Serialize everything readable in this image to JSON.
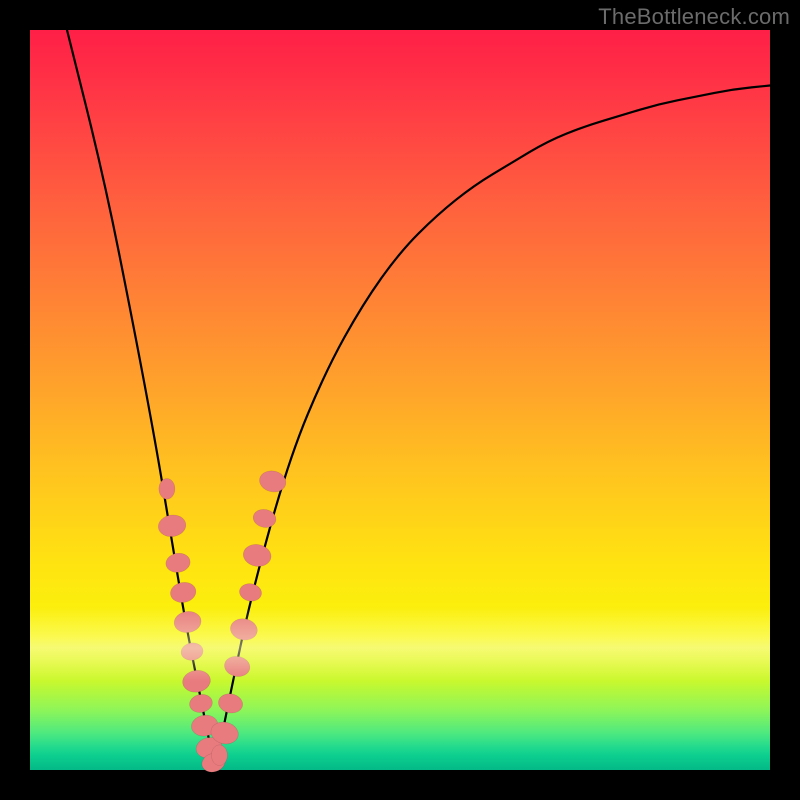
{
  "watermark": "TheBottleneck.com",
  "colors": {
    "bead": "#e87b7e",
    "curve": "#000000",
    "frame": "#000000"
  },
  "chart_data": {
    "type": "line",
    "title": "",
    "xlabel": "",
    "ylabel": "",
    "xlim": [
      0,
      100
    ],
    "ylim": [
      0,
      100
    ],
    "grid": false,
    "legend": false,
    "notes": "V-shaped bottleneck curve on a vertical color gradient; y ≈ 100 (red, severe) at top, y ≈ 0 (green, balanced) at bottom. Minimum at x ≈ 25. Pink beads mark sampled points near the minimum.",
    "series": [
      {
        "name": "bottleneck-curve",
        "x": [
          5,
          10,
          14,
          17,
          19,
          21,
          23,
          25,
          27,
          30,
          35,
          40,
          45,
          50,
          55,
          60,
          65,
          70,
          75,
          80,
          85,
          90,
          95,
          100
        ],
        "y": [
          100,
          80,
          60,
          44,
          32,
          20,
          10,
          0,
          10,
          24,
          42,
          54,
          63,
          70,
          75,
          79,
          82,
          85,
          87,
          88.5,
          90,
          91,
          92,
          92.5
        ]
      }
    ],
    "beads_left": {
      "name": "samples-left-branch",
      "x": [
        18.5,
        19.2,
        20.0,
        20.7,
        21.3,
        21.9,
        22.5,
        23.1,
        23.6,
        24.2,
        24.8
      ],
      "y": [
        38,
        33,
        28,
        24,
        20,
        16,
        12,
        9,
        6,
        3,
        1
      ]
    },
    "beads_right": {
      "name": "samples-right-branch",
      "x": [
        25.6,
        26.3,
        27.1,
        28.0,
        28.9,
        29.8,
        30.7,
        31.7,
        32.8
      ],
      "y": [
        2,
        5,
        9,
        14,
        19,
        24,
        29,
        34,
        39
      ]
    }
  }
}
